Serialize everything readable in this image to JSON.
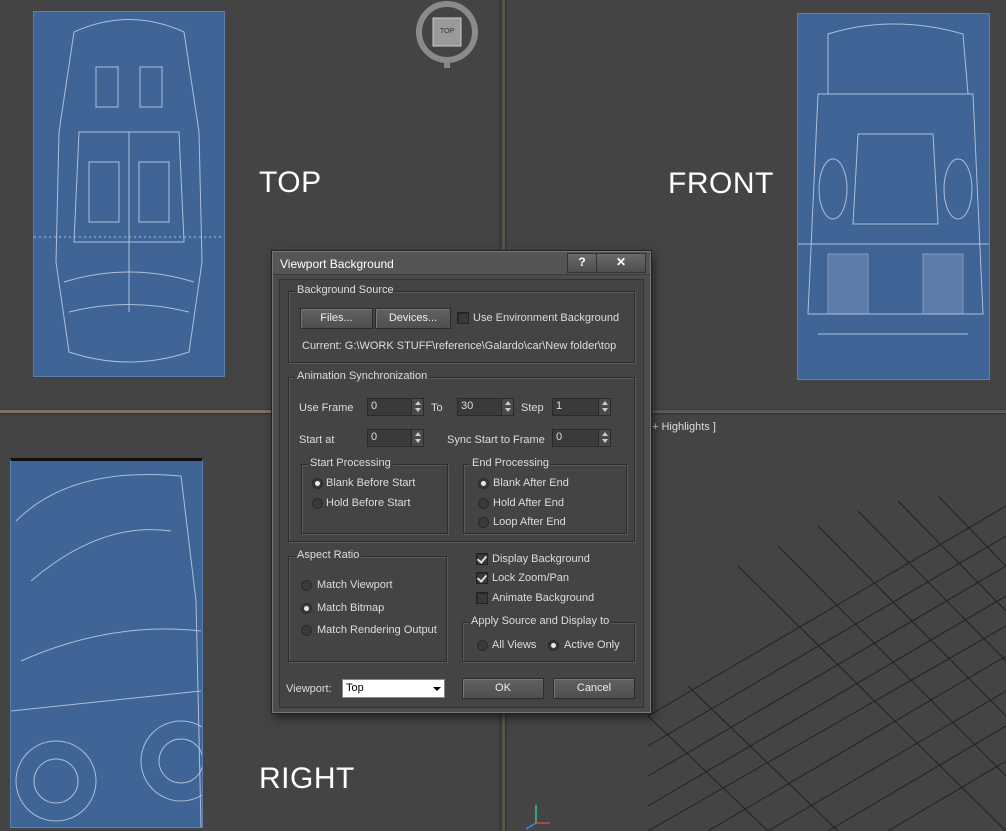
{
  "viewports": {
    "top_label": "TOP",
    "front_label": "FRONT",
    "right_label": "RIGHT",
    "viewcube_label": "TOP",
    "perspective_label_fragment": "+ Highlights ]"
  },
  "dialog": {
    "title": "Viewport Background",
    "help_label": "?",
    "close_label": "✕",
    "background_source": {
      "group_label": "Background Source",
      "files_label": "Files...",
      "devices_label": "Devices...",
      "use_env_label": "Use Environment Background",
      "use_env_checked": false,
      "current_text": "Current: G:\\WORK STUFF\\reference\\Galardo\\car\\New folder\\top"
    },
    "animation_sync": {
      "group_label": "Animation Synchronization",
      "use_frame_label": "Use Frame",
      "use_frame_value": "0",
      "to_label": "To",
      "to_value": "30",
      "step_label": "Step",
      "step_value": "1",
      "start_at_label": "Start at",
      "start_at_value": "0",
      "sync_start_label": "Sync Start to Frame",
      "sync_start_value": "0",
      "start_processing": {
        "group_label": "Start Processing",
        "options": [
          "Blank Before Start",
          "Hold Before Start"
        ],
        "selected": 0
      },
      "end_processing": {
        "group_label": "End Processing",
        "options": [
          "Blank After End",
          "Hold After End",
          "Loop After End"
        ],
        "selected": 0
      }
    },
    "aspect_ratio": {
      "group_label": "Aspect Ratio",
      "options": [
        "Match Viewport",
        "Match Bitmap",
        "Match Rendering Output"
      ],
      "selected": 1
    },
    "display_options": {
      "display_background_label": "Display Background",
      "display_background_checked": true,
      "lock_zoom_label": "Lock Zoom/Pan",
      "lock_zoom_checked": true,
      "animate_background_label": "Animate Background",
      "animate_background_checked": false
    },
    "apply_source": {
      "group_label": "Apply Source and Display to",
      "options": [
        "All Views",
        "Active Only"
      ],
      "selected": 1
    },
    "viewport_label": "Viewport:",
    "viewport_value": "Top",
    "ok_label": "OK",
    "cancel_label": "Cancel"
  }
}
